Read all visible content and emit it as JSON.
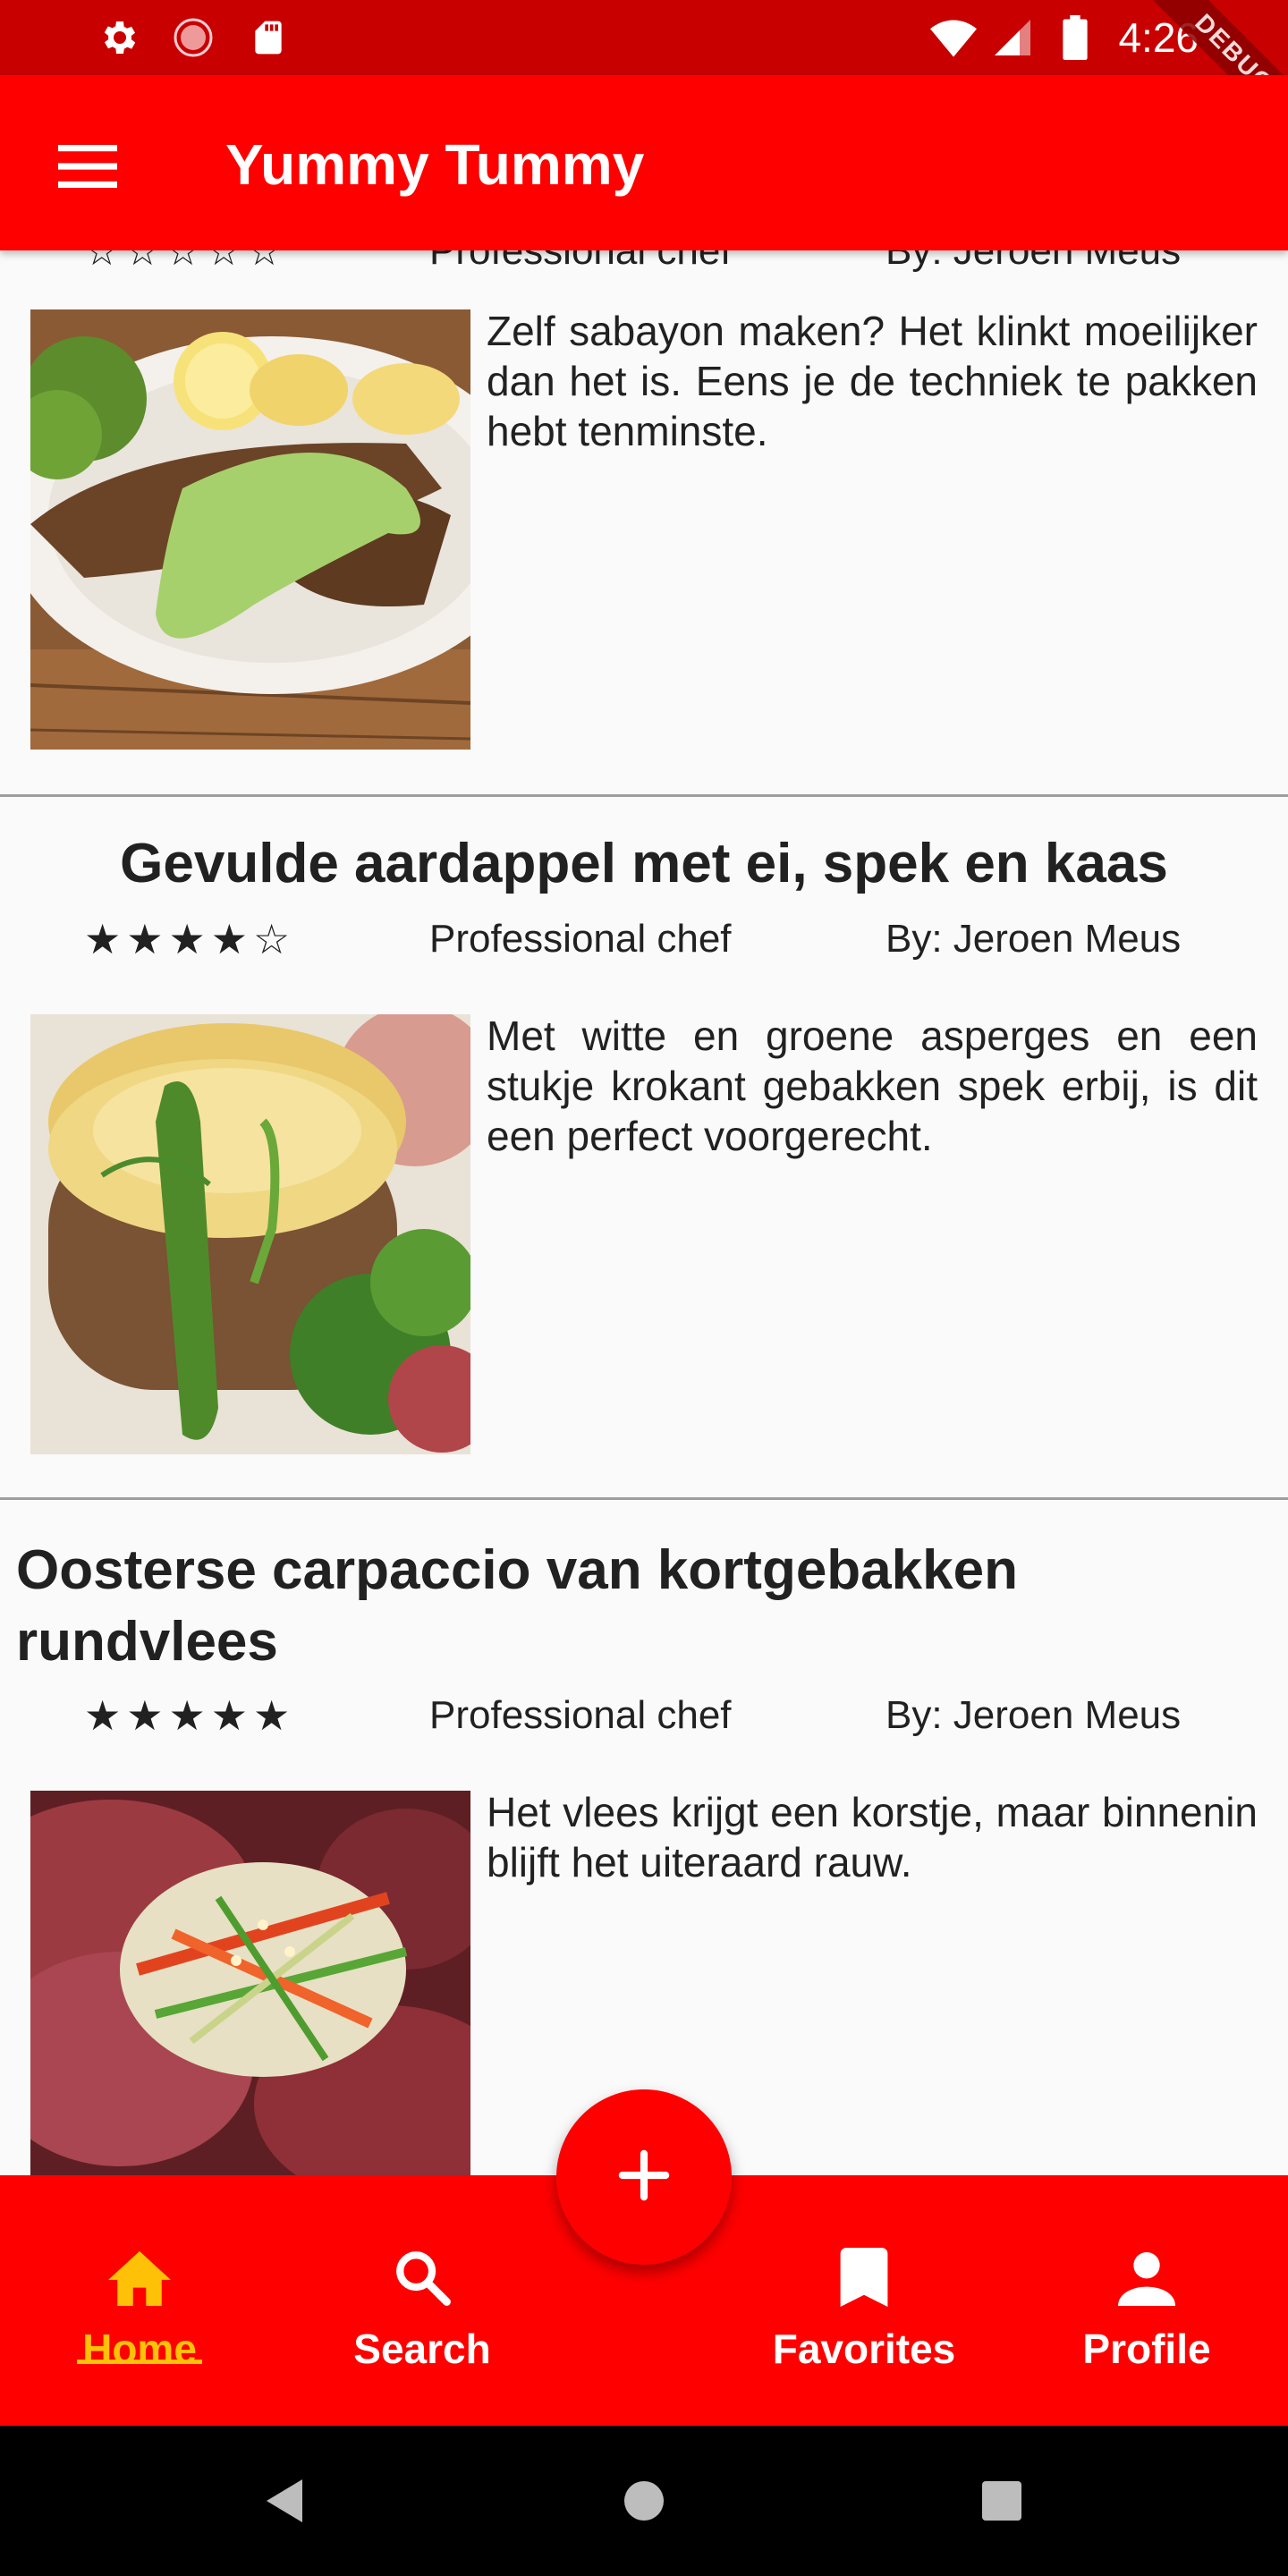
{
  "status_bar": {
    "time": "4:26",
    "debug_label": "DEBUG",
    "icons": [
      "settings-icon",
      "record-icon",
      "sd-card-icon",
      "wifi-icon",
      "signal-icon",
      "battery-icon"
    ]
  },
  "app_bar": {
    "title": "Yummy Tummy",
    "menu_icon": "menu-icon"
  },
  "partial_recipe": {
    "rating_stars": "☆☆☆☆☆",
    "chef": "Professional chef",
    "author": "By: Jeroen Meus",
    "description": "Zelf sabayon maken? Het klinkt moeilijker dan het is. Eens je de techniek te pakken hebt tenminste.",
    "image": "fish-with-green-sauce"
  },
  "recipes": [
    {
      "title": "Gevulde aardappel met ei, spek en kaas",
      "rating_stars": "★★★★☆",
      "rating": 4,
      "chef": "Professional chef",
      "author": "By: Jeroen Meus",
      "description": "Met witte en groene asperges en een stukje krokant gebakken spek erbij, is dit een perfect voorgerecht.",
      "image": "stuffed-potato"
    },
    {
      "title": "Oosterse carpaccio van kortgebakken rundvlees",
      "rating_stars": "★★★★★",
      "rating": 5,
      "chef": "Professional chef",
      "author": "By: Jeroen Meus",
      "description": "Het vlees krijgt een korstje, maar binnenin blijft het uiteraard rauw.",
      "image": "beef-carpaccio"
    }
  ],
  "fab": {
    "icon": "plus-icon"
  },
  "bottom_nav": {
    "active": "Home",
    "items": [
      {
        "label": "Home",
        "icon": "home-icon"
      },
      {
        "label": "Search",
        "icon": "search-icon"
      },
      {
        "label": "Favorites",
        "icon": "bookmark-icon"
      },
      {
        "label": "Profile",
        "icon": "person-icon"
      }
    ]
  },
  "colors": {
    "primary": "#ff0000",
    "status_bar": "#c80000",
    "active_nav": "#ffc107",
    "background": "#fafafa"
  }
}
